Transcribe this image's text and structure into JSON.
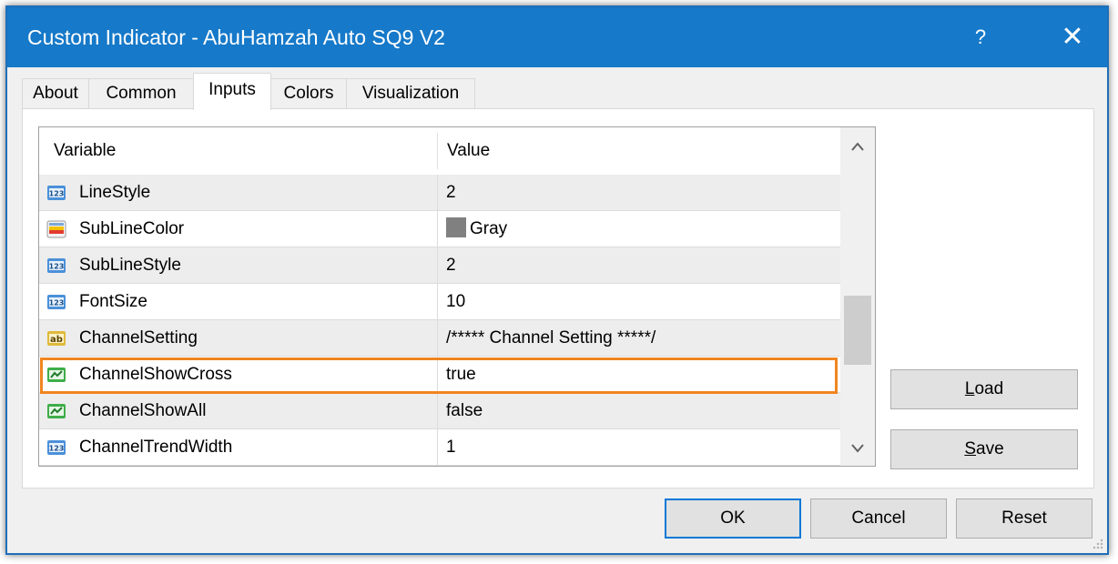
{
  "window": {
    "title": "Custom Indicator - AbuHamzah Auto SQ9 V2",
    "help_label": "?",
    "close_label": "✕"
  },
  "tabs": [
    {
      "label": "About",
      "active": false
    },
    {
      "label": "Common",
      "active": false
    },
    {
      "label": "Inputs",
      "active": true
    },
    {
      "label": "Colors",
      "active": false
    },
    {
      "label": "Visualization",
      "active": false
    }
  ],
  "grid": {
    "columns": [
      "Variable",
      "Value"
    ],
    "rows": [
      {
        "icon": "number-icon",
        "variable": "LineStyle",
        "value": "2"
      },
      {
        "icon": "color-icon",
        "variable": "SubLineColor",
        "value": "Gray",
        "swatch": "#808080"
      },
      {
        "icon": "number-icon",
        "variable": "SubLineStyle",
        "value": "2"
      },
      {
        "icon": "number-icon",
        "variable": "FontSize",
        "value": "10"
      },
      {
        "icon": "string-icon",
        "variable": "ChannelSetting",
        "value": "/***** Channel Setting *****/"
      },
      {
        "icon": "boolean-icon",
        "variable": "ChannelShowCross",
        "value": "true",
        "highlighted": true
      },
      {
        "icon": "boolean-icon",
        "variable": "ChannelShowAll",
        "value": "false"
      },
      {
        "icon": "number-icon",
        "variable": "ChannelTrendWidth",
        "value": "1"
      }
    ],
    "scroll_up": "^",
    "scroll_down": "v"
  },
  "side_buttons": {
    "load": {
      "prefix": "",
      "underline": "L",
      "rest": "oad"
    },
    "save": {
      "prefix": "",
      "underline": "S",
      "rest": "ave"
    }
  },
  "footer_buttons": {
    "ok": "OK",
    "cancel": "Cancel",
    "reset": "Reset"
  },
  "colors": {
    "titlebar": "#1679c9",
    "highlight": "#f0851f",
    "default_button_border": "#0078d7"
  }
}
